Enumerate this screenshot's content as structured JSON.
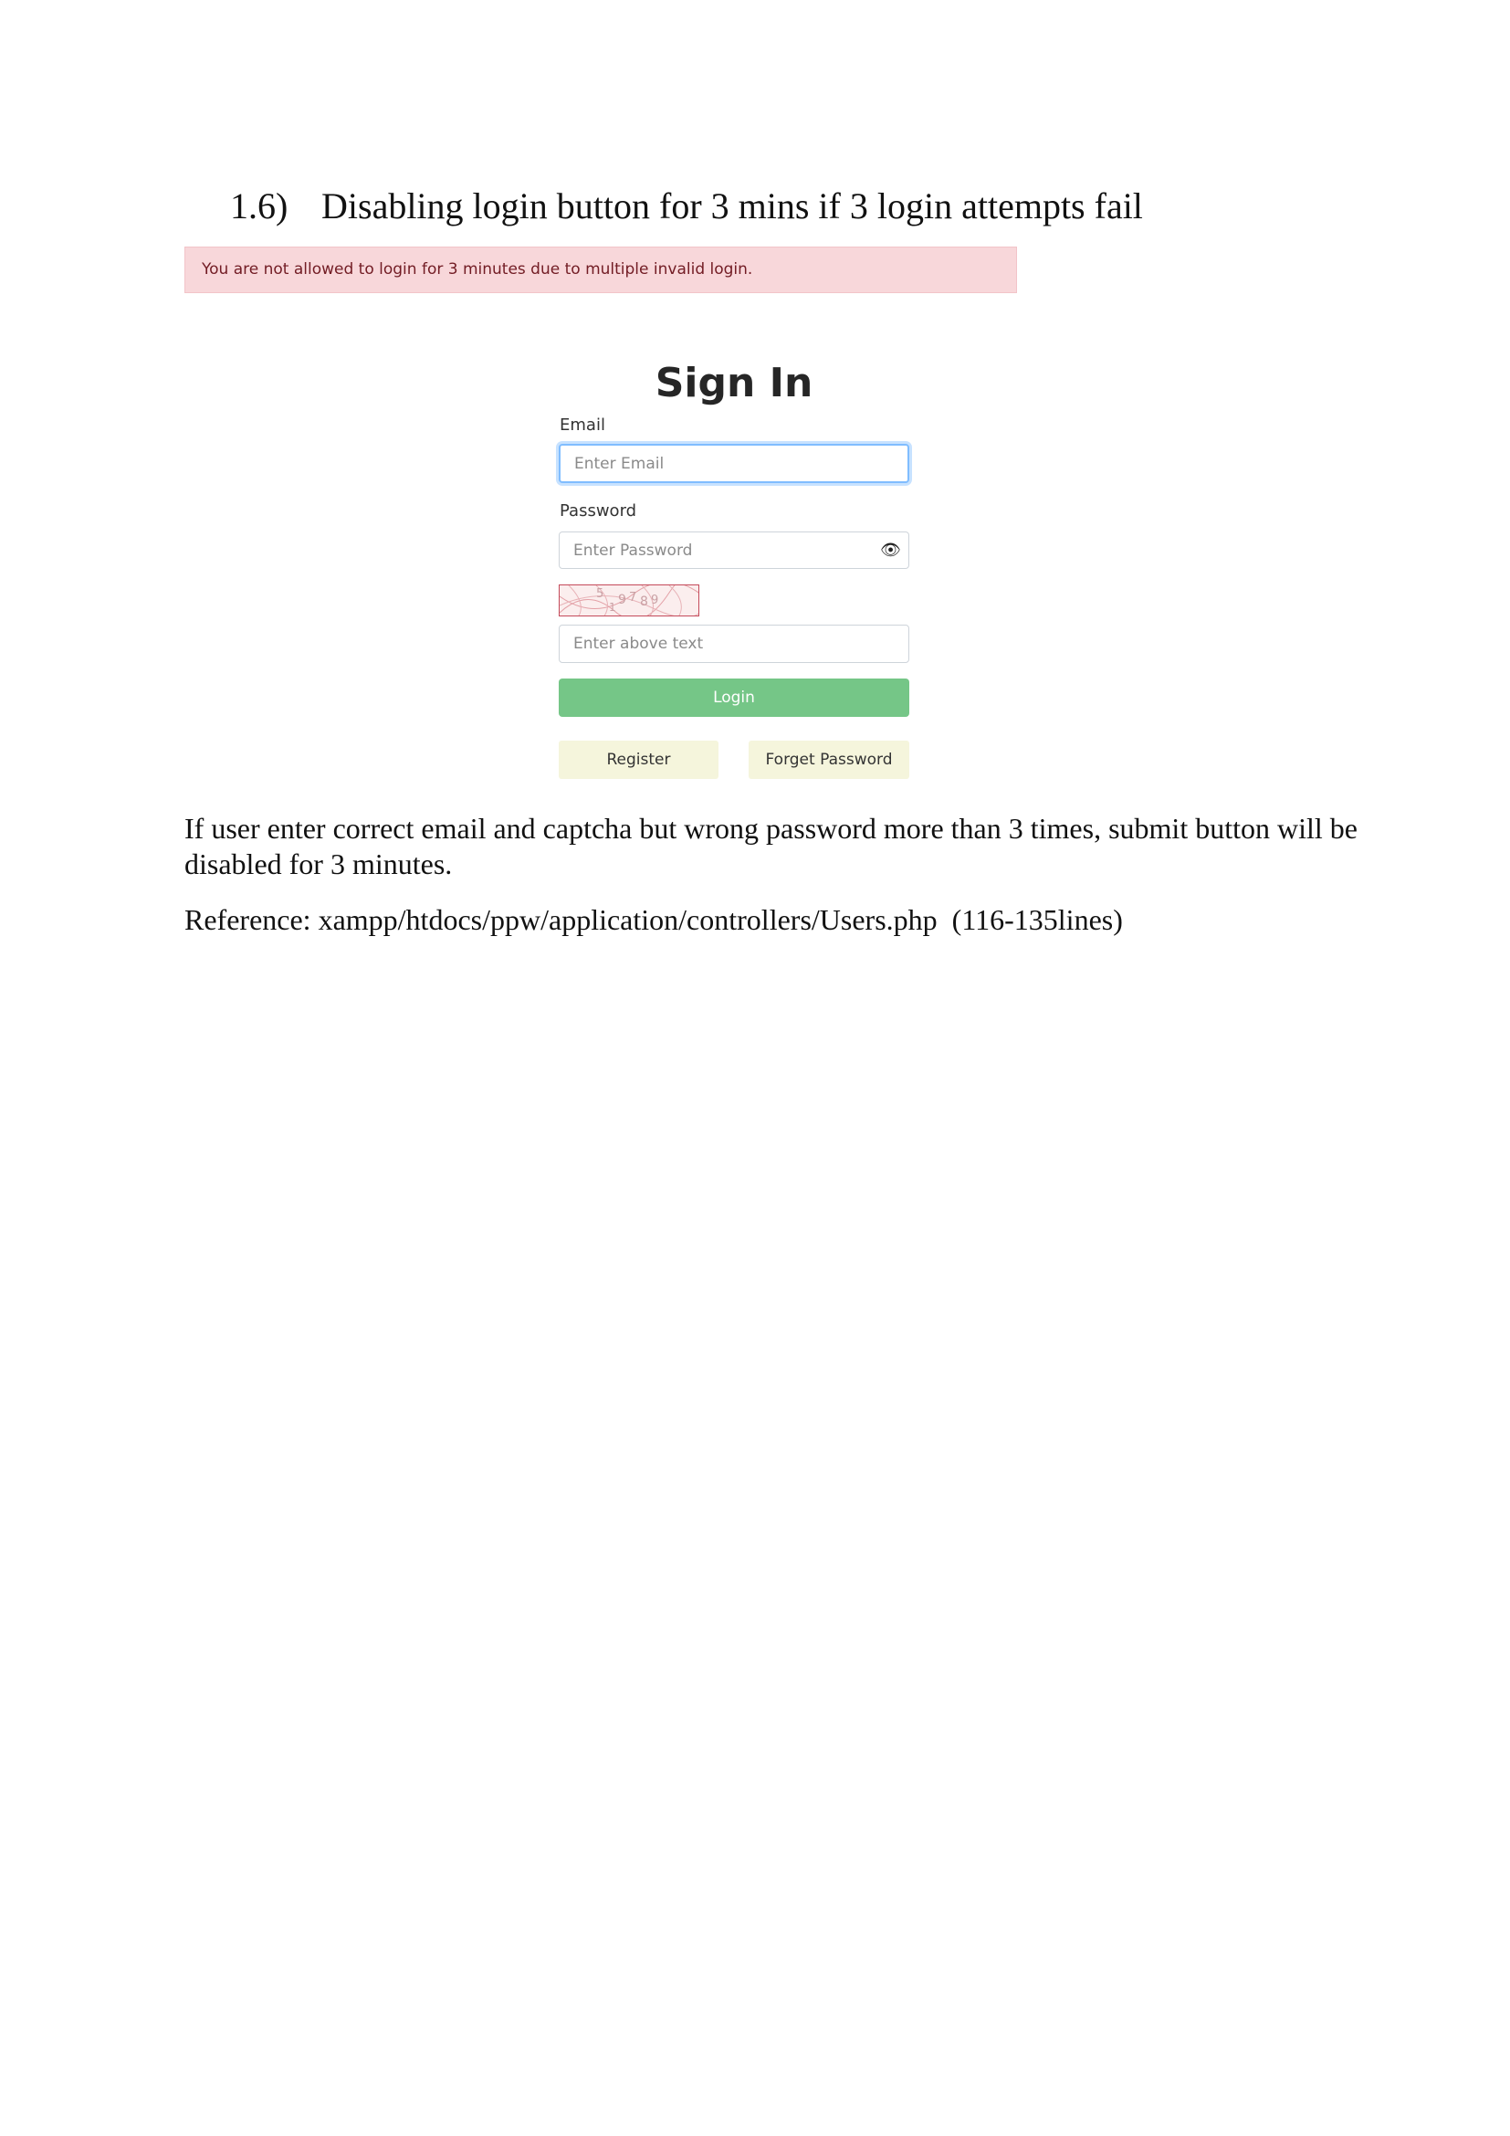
{
  "heading": {
    "number": "1.6)",
    "text": "Disabling login button for 3 mins if 3 login attempts fail"
  },
  "alert": {
    "message": "You are not allowed to login for 3 minutes due to multiple invalid login.",
    "color": "#f8d7da"
  },
  "form": {
    "title": "Sign In",
    "email_label": "Email",
    "email_placeholder": "Enter Email",
    "password_label": "Password",
    "password_placeholder": "Enter Password",
    "password_icon": "eye-icon",
    "captcha_text": "5 1 9 7 8 9",
    "captcha_placeholder": "Enter above text",
    "login_label": "Login",
    "login_color": "#75c687",
    "register_label": "Register",
    "forget_label": "Forget Password"
  },
  "body_text": {
    "description": "If user enter correct email and captcha but wrong password more than 3 times, submit button will be disabled for 3 minutes.",
    "reference": "Reference: xampp/htdocs/ppw/application/controllers/Users.php  (116-135lines)"
  }
}
